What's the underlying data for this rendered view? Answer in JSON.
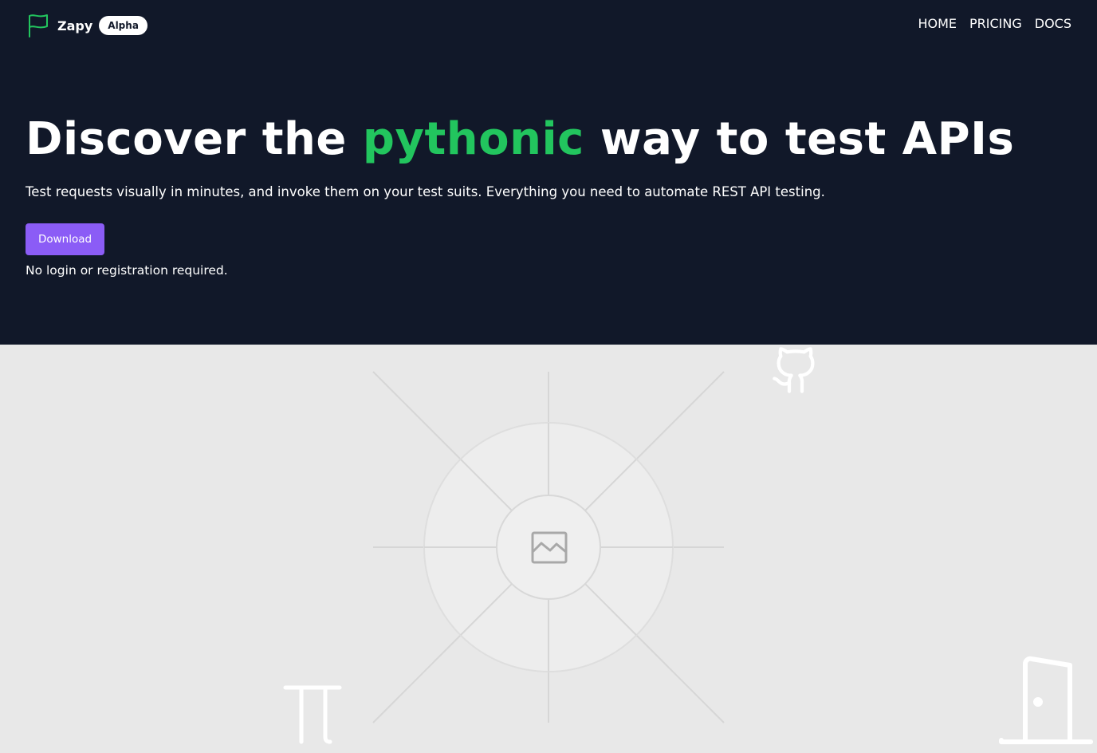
{
  "nav": {
    "brand_icon": "flag-icon",
    "brand_name": "Zapy",
    "badge": "Alpha",
    "links": [
      {
        "label": "HOME"
      },
      {
        "label": "PRICING"
      },
      {
        "label": "DOCS"
      }
    ]
  },
  "hero": {
    "headline_before": "Discover the ",
    "headline_accent": "pythonic",
    "headline_after": " way to test APIs",
    "subtitle": "Test requests visually in minutes, and invoke them on your test suits. Everything you need to automate REST API testing.",
    "download_label": "Download",
    "note": "No login or registration required."
  },
  "lower": {
    "image_placeholder_icon": "image-icon",
    "icons": [
      "github-icon",
      "pi-icon",
      "door-icon"
    ]
  },
  "colors": {
    "hero_background": "#111829",
    "accent_green": "#22c55e",
    "button_purple": "#8b5cf6",
    "lower_background": "#e8e8e8"
  }
}
